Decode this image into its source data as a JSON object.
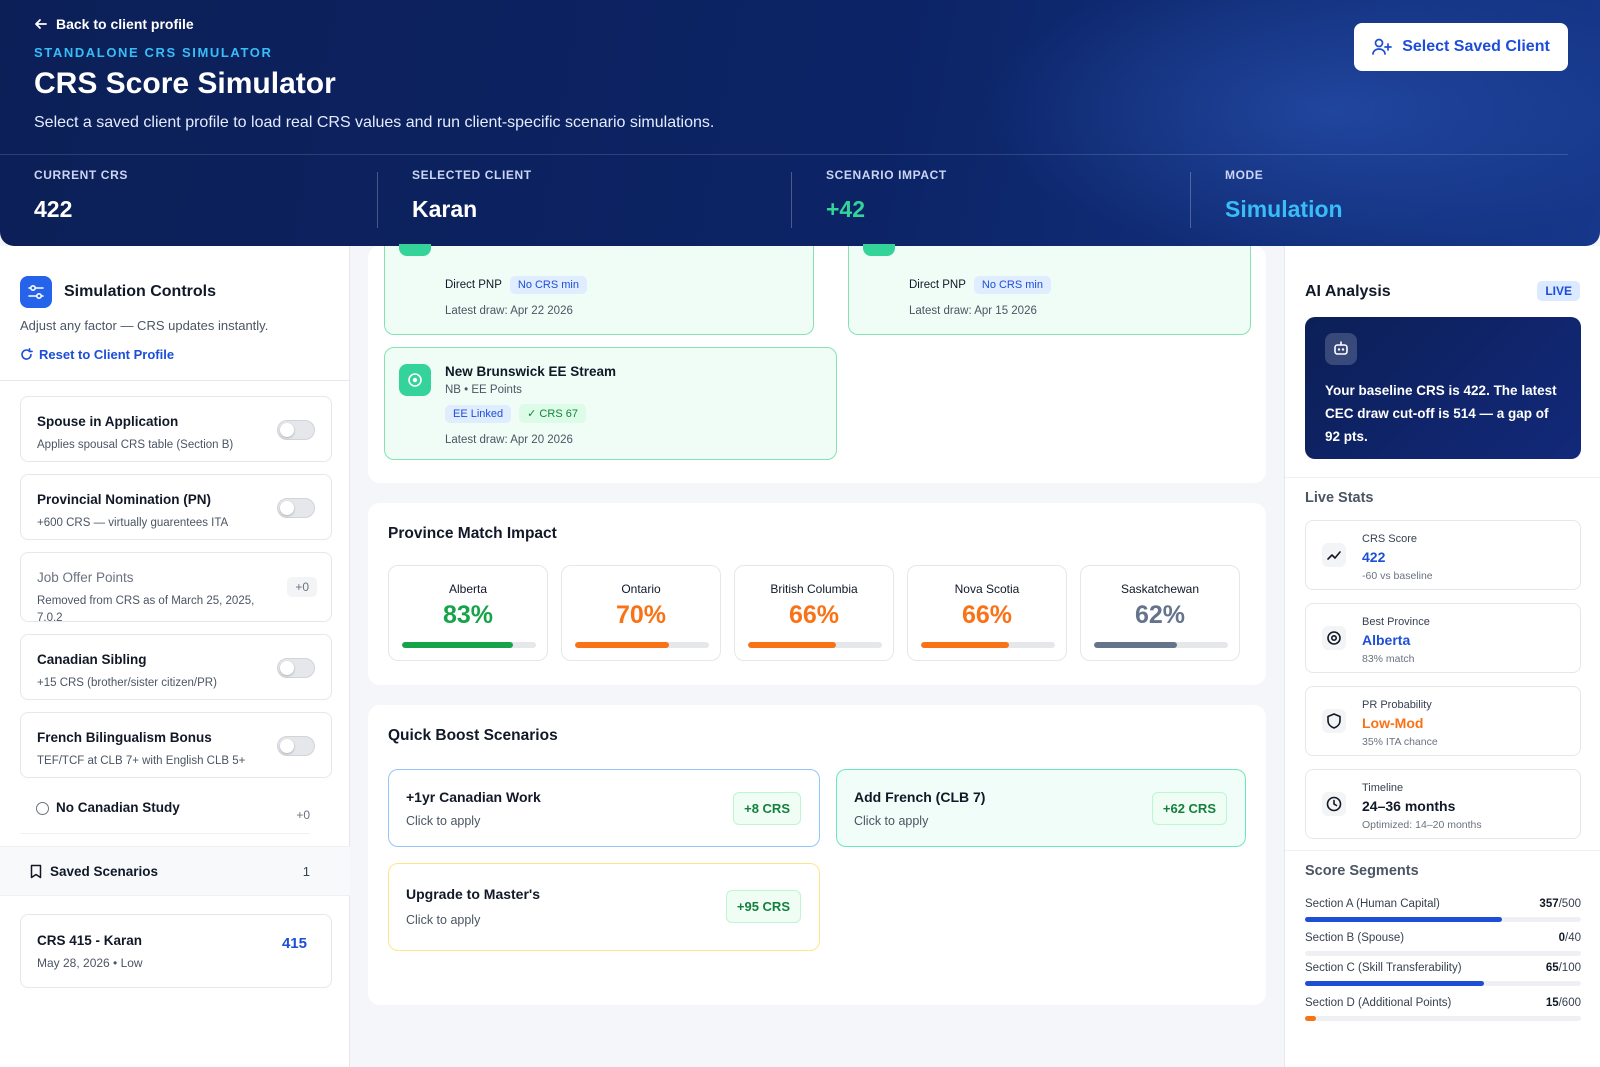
{
  "header": {
    "back_label": "Back to client profile",
    "eyebrow": "STANDALONE CRS SIMULATOR",
    "title": "CRS Score Simulator",
    "subtitle": "Select a saved client profile to load real CRS values and run client-specific scenario simulations.",
    "select_button": "Select Saved Client",
    "stats": [
      {
        "label": "CURRENT CRS",
        "value": "422",
        "color": "#ffffff"
      },
      {
        "label": "SELECTED CLIENT",
        "value": "Karan",
        "color": "#ffffff"
      },
      {
        "label": "SCENARIO IMPACT",
        "value": "+42",
        "color": "#34d399"
      },
      {
        "label": "MODE",
        "value": "Simulation",
        "color": "#38bdf8"
      }
    ]
  },
  "controls": {
    "title": "Simulation Controls",
    "subtitle": "Adjust any factor — CRS updates instantly.",
    "reset_label": "Reset to Client Profile",
    "items": [
      {
        "title": "Spouse in Application",
        "desc": "Applies spousal CRS table (Section B)"
      },
      {
        "title": "Provincial Nomination (PN)",
        "desc": "+600 CRS — virtually guarentees ITA"
      },
      {
        "title": "Job Offer Points",
        "desc": "Removed from CRS as of March 25, 2025, 7.0.2",
        "value": "+0"
      },
      {
        "title": "Canadian Sibling",
        "desc": "+15 CRS (brother/sister citizen/PR)"
      },
      {
        "title": "French Bilingualism Bonus",
        "desc": "TEF/TCF at CLB 7+ with English CLB 5+"
      }
    ],
    "study": {
      "label": "No Canadian Study",
      "value": "+0"
    }
  },
  "saved": {
    "title": "Saved Scenarios",
    "count": "1",
    "items": [
      {
        "title": "CRS 415 - Karan",
        "meta": "May 28, 2026 • Low",
        "score": "415"
      }
    ]
  },
  "provinces_cards": [
    {
      "stream": "Direct PNP",
      "tag": "No CRS min",
      "draw": "Latest draw: Apr 22 2026"
    },
    {
      "stream": "Direct PNP",
      "tag": "No CRS min",
      "draw": "Latest draw: Apr 15 2026"
    },
    {
      "name": "New Brunswick EE Stream",
      "sub": "NB • EE Points",
      "tag1": "EE Linked",
      "tag2": "✓ CRS 67",
      "draw": "Latest draw: Apr 20 2026"
    }
  ],
  "province_match": {
    "title": "Province Match Impact",
    "items": [
      {
        "name": "Alberta",
        "pct": "83%",
        "value": 0.83,
        "color": "#16a34a"
      },
      {
        "name": "Ontario",
        "pct": "70%",
        "value": 0.7,
        "color": "#f97316"
      },
      {
        "name": "British Columbia",
        "pct": "66%",
        "value": 0.66,
        "color": "#f97316"
      },
      {
        "name": "Nova Scotia",
        "pct": "66%",
        "value": 0.66,
        "color": "#f97316"
      },
      {
        "name": "Saskatchewan",
        "pct": "62%",
        "value": 0.62,
        "color": "#64748b"
      }
    ]
  },
  "boost": {
    "title": "Quick Boost Scenarios",
    "items": [
      {
        "title": "+1yr Canadian Work",
        "desc": "Click to apply",
        "badge": "+8 CRS"
      },
      {
        "title": "Add French (CLB 7)",
        "desc": "Click to apply",
        "badge": "+62 CRS"
      },
      {
        "title": "Upgrade to Master's",
        "desc": "Click to apply",
        "badge": "+95 CRS"
      }
    ]
  },
  "ai": {
    "title": "AI Analysis",
    "badge": "LIVE",
    "text": "Your baseline CRS is 422. The latest CEC draw cut-off is 514 — a gap of 92 pts."
  },
  "live_stats": {
    "title": "Live Stats",
    "items": [
      {
        "label": "CRS Score",
        "value": "422",
        "sub": "-60 vs baseline",
        "color": "#1d4ed8",
        "icon": "trend-icon"
      },
      {
        "label": "Best Province",
        "value": "Alberta",
        "sub": "83% match",
        "color": "#1d4ed8",
        "icon": "target-icon"
      },
      {
        "label": "PR Probability",
        "value": "Low-Mod",
        "sub": "35% ITA chance",
        "color": "#f97316",
        "icon": "shield-icon"
      },
      {
        "label": "Timeline",
        "value": "24–36 months",
        "sub": "Optimized: 14–20 months",
        "color": "#111827",
        "icon": "clock-icon"
      }
    ]
  },
  "segments": {
    "title": "Score Segments",
    "items": [
      {
        "label": "Section A (Human Capital)",
        "score": "357",
        "max": "/500",
        "value": 0.714,
        "color": "#1d4ed8"
      },
      {
        "label": "Section B (Spouse)",
        "score": "0",
        "max": "/40",
        "value": 0.0,
        "color": "#1d4ed8"
      },
      {
        "label": "Section C (Skill Transferability)",
        "score": "65",
        "max": "/100",
        "value": 0.65,
        "color": "#1d4ed8"
      },
      {
        "label": "Section D (Additional Points)",
        "score": "15",
        "max": "/600",
        "value": 0.025,
        "color": "#f97316"
      }
    ]
  }
}
